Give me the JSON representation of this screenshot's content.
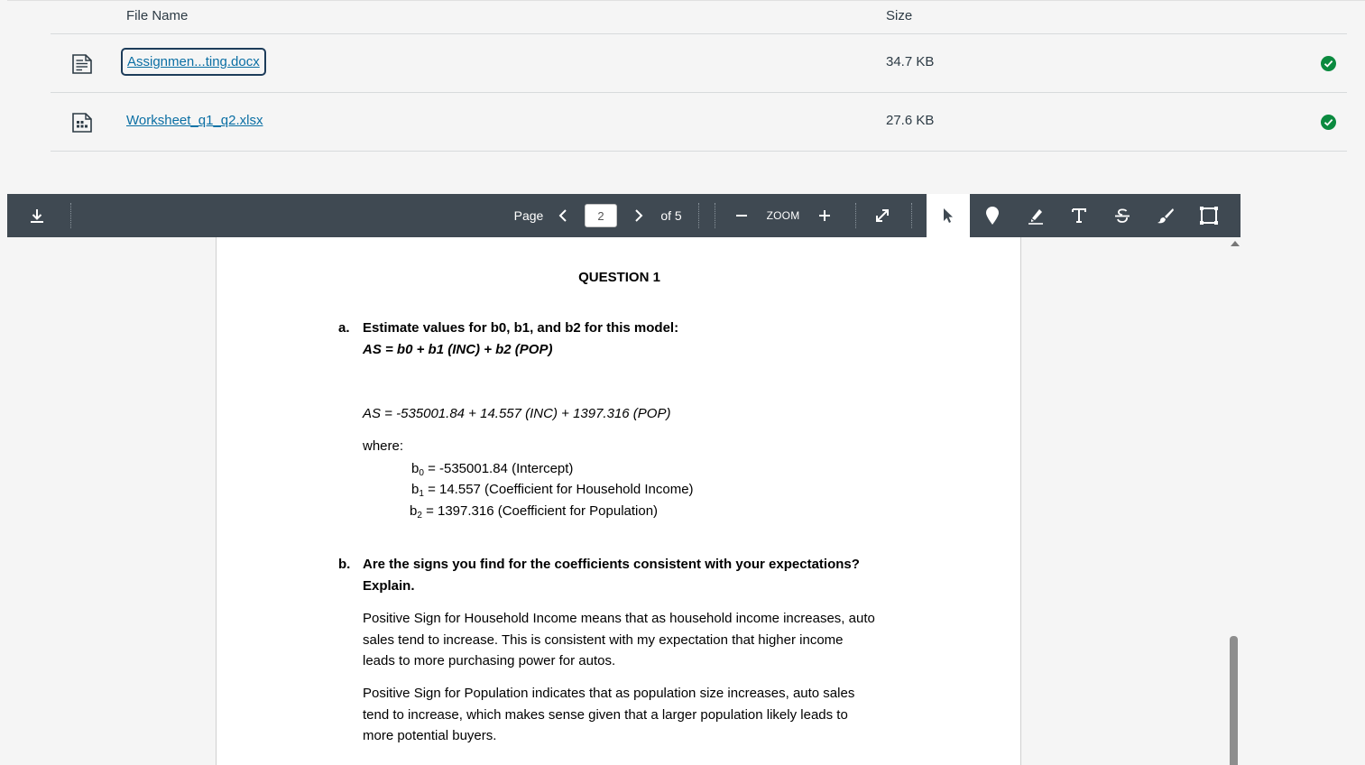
{
  "files": {
    "header": {
      "name": "File Name",
      "size": "Size"
    },
    "rows": [
      {
        "name": "Assignmen...ting.docx",
        "size": "34.7 KB",
        "icon": "document-icon"
      },
      {
        "name": "Worksheet_q1_q2.xlsx",
        "size": "27.6 KB",
        "icon": "spreadsheet-icon"
      }
    ]
  },
  "toolbar": {
    "page_label": "Page",
    "page_value": "2",
    "of_label": "of 5",
    "zoom_label": "ZOOM"
  },
  "doc": {
    "title": "QUESTION 1",
    "a_marker": "a.",
    "a_text": "Estimate values for b0, b1, and b2 for this model:",
    "a_model": "AS = b0 + b1 (INC) + b2 (POP)",
    "equation": "AS = -535001.84 + 14.557 (INC) + 1397.316 (POP)",
    "where": "where:",
    "coef0_rest": " = -535001.84 (Intercept)",
    "coef1_rest": " = 14.557 (Coefficient for Household Income)",
    "coef2_rest": " = 1397.316 (Coefficient for Population)",
    "b_marker": "b.",
    "b_text_1": "Are the signs you find for the coefficients consistent with your expectations?",
    "b_text_2": "Explain.",
    "para1_1": "Positive Sign for Household Income means that as household income increases, auto",
    "para1_2": "sales tend to increase. This is consistent with my expectation that higher income",
    "para1_3": "leads to more purchasing power for autos.",
    "para2_1": "Positive Sign for Population indicates that as population size increases, auto sales",
    "para2_2": "tend to increase, which makes sense given that a larger population likely leads to",
    "para2_3": "more potential buyers."
  }
}
